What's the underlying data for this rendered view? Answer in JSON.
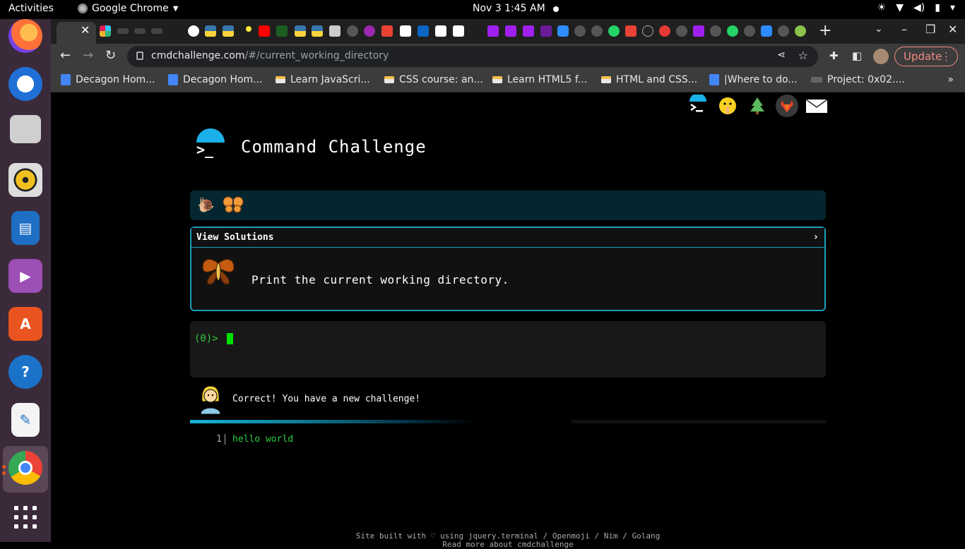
{
  "os": {
    "activities": "Activities",
    "app_name": "Google Chrome",
    "clock": "Nov 3  1:45 AM",
    "tray_icons": [
      "brightness-icon",
      "wifi-icon",
      "volume-icon",
      "battery-icon",
      "power-menu-icon"
    ]
  },
  "dock": {
    "apps": [
      "firefox",
      "thunderbird",
      "files",
      "rhythmbox",
      "libreoffice-impress",
      "videos",
      "ubuntu-software",
      "help",
      "text-editor",
      "google-chrome"
    ],
    "show_apps": "show-applications"
  },
  "browser": {
    "url_host": "cmdchallenge.com",
    "url_path": "/#/current_working_directory",
    "update_label": "Update",
    "bookmarks": [
      {
        "label": "Decagon Hom...",
        "icon": "doc"
      },
      {
        "label": "Decagon Hom...",
        "icon": "doc"
      },
      {
        "label": "Learn JavaScri...",
        "icon": "brush"
      },
      {
        "label": "CSS course: an...",
        "icon": "brush"
      },
      {
        "label": "Learn HTML5 f...",
        "icon": "brush"
      },
      {
        "label": "HTML and CSS...",
        "icon": "brush"
      },
      {
        "label": "|Where to do...",
        "icon": "doc"
      },
      {
        "label": "Project: 0x02....",
        "icon": "grey"
      }
    ],
    "more_bookmarks": "»"
  },
  "page": {
    "title": "Command Challenge",
    "view_solutions": "View Solutions",
    "view_solutions_chevron": "›",
    "task": "Print the current working directory.",
    "prompt": "(0)>",
    "feedback": "Correct! You have a new challenge!",
    "output_line_number": "1",
    "output_text": "hello world",
    "footer_line1": "Site built with ♡ using jquery.terminal / Openmoji / Nim / Golang",
    "footer_line2": "Read more about cmdchallenge",
    "progress": 0.6
  },
  "colors": {
    "accent": "#1a9fbd",
    "terminal_green": "#2ecc40",
    "update_red": "#f28b82"
  }
}
